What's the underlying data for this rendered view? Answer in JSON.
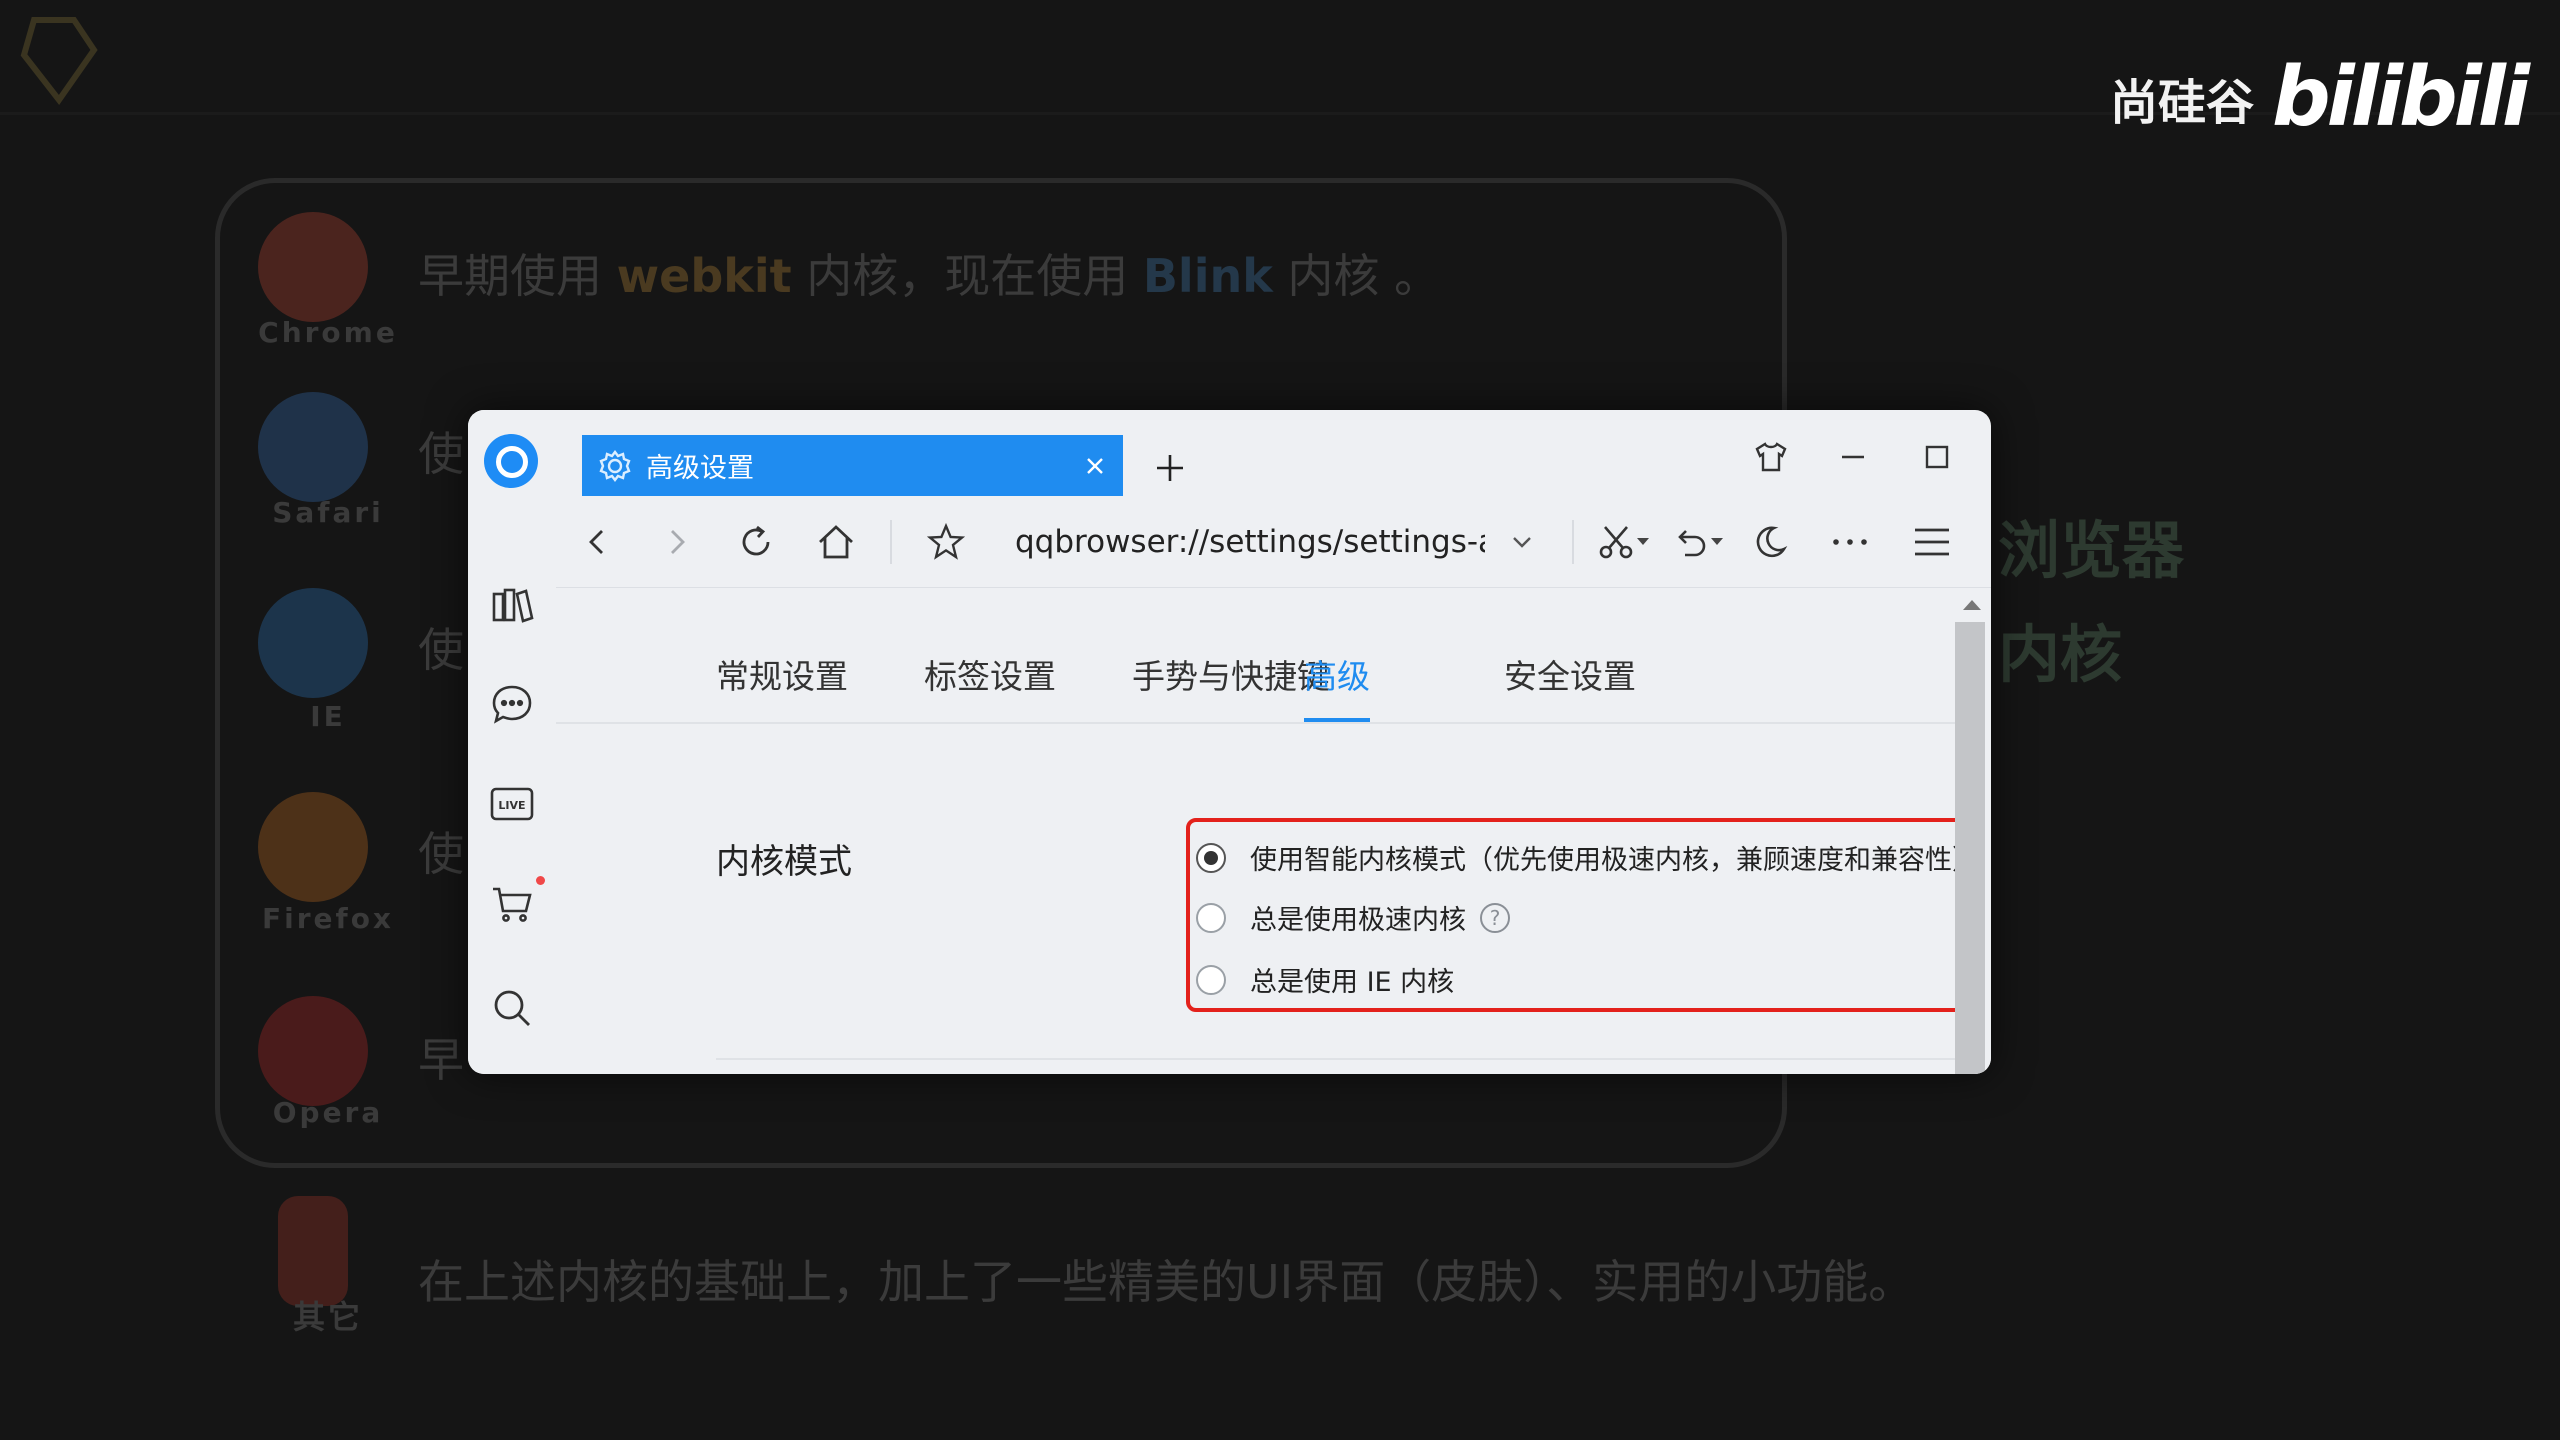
{
  "background": {
    "browsers": [
      {
        "name": "Chrome",
        "desc_parts": [
          "早期使用 ",
          "webkit",
          " 内核，现在使用 ",
          "Blink",
          " 内核 。"
        ],
        "color": "#d64a36"
      },
      {
        "name": "Safari",
        "desc_parts": [
          "使"
        ],
        "color": "#3a7fd0"
      },
      {
        "name": "IE",
        "desc_parts": [
          "使"
        ],
        "color": "#2f84d6"
      },
      {
        "name": "Firefox",
        "desc_parts": [
          "使"
        ],
        "color": "#e07a20"
      },
      {
        "name": "Opera",
        "desc_parts": [
          "早"
        ],
        "color": "#d42a2a"
      },
      {
        "name": "其它",
        "desc_parts": [
          "在上述内核的基础上，加上了一些精美的UI界面（皮肤）、实用的小功能。"
        ],
        "color": "#c03a2a"
      }
    ],
    "side_text_1": "浏览器",
    "side_text_2": "内核"
  },
  "brand": {
    "cn": "尚硅谷",
    "logo": "bilibili"
  },
  "window": {
    "tab_title": "高级设置",
    "new_tab": "+",
    "address": "qqbrowser://settings/settings-a",
    "accent": "#1f8cf0"
  },
  "settings": {
    "tabs": [
      {
        "label": "常规设置"
      },
      {
        "label": "标签设置"
      },
      {
        "label": "手势与快捷键"
      },
      {
        "label": "高级"
      },
      {
        "label": "安全设置"
      }
    ],
    "active_tab": "高级",
    "kernel": {
      "label": "内核模式",
      "options": [
        {
          "text": "使用智能内核模式（优先使用极速内核，兼顾速度和兼容性）",
          "selected": true
        },
        {
          "text": "总是使用极速内核",
          "selected": false,
          "help": "?"
        },
        {
          "text": "总是使用 IE 内核",
          "selected": false
        }
      ],
      "highlight_color": "#e3211b"
    }
  }
}
